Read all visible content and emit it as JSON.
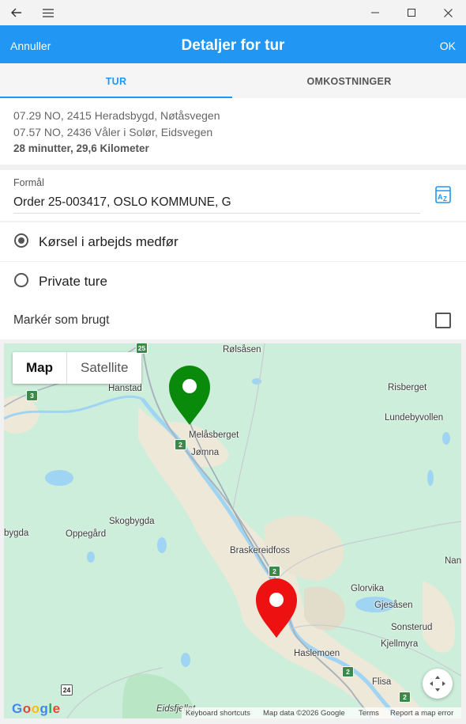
{
  "titlebar": {
    "back_icon": "arrow-left-icon",
    "menu_icon": "hamburger-icon",
    "minimize_icon": "minimize-icon",
    "maximize_icon": "maximize-icon",
    "close_icon": "close-icon"
  },
  "appbar": {
    "cancel": "Annuller",
    "title": "Detaljer for tur",
    "ok": "OK",
    "color": "#2196f3"
  },
  "tabs": [
    {
      "label": "TUR",
      "active": true
    },
    {
      "label": "OMKOSTNINGER",
      "active": false
    }
  ],
  "trip": {
    "start": "07.29 NO, 2415 Heradsbygd, Nøtåsvegen",
    "end": "07.57 NO, 2436 Våler i Solør, Eidsvegen",
    "summary": "28 minutter, 29,6 Kilometer"
  },
  "purpose": {
    "label": "Formål",
    "value": "Order 25-003417, OSLO KOMMUNE, G",
    "sort_icon": "az-sort-icon"
  },
  "trip_type": {
    "options": [
      "Kørsel i arbejds medfør",
      "Private ture"
    ],
    "selected": 0
  },
  "mark_used": {
    "label": "Markér som brugt",
    "checked": false
  },
  "map": {
    "type_buttons": {
      "map": "Map",
      "satellite": "Satellite"
    },
    "selected_type": "Map",
    "places": {
      "rolsasen": "Rølsåsen",
      "hanstad": "Hanstad",
      "risberget": "Risberget",
      "lundebyvollen": "Lundebyvollen",
      "melasberget": "Melåsberget",
      "jomna": "Jømna",
      "skogbygda": "Skogbygda",
      "oppegard": "Oppegård",
      "bygda": "bygda",
      "braskereidfoss": "Braskereidfoss",
      "nan": "Nan",
      "glorvika": "Glorvika",
      "gjesasen": "Gjesåsen",
      "sonsterud": "Sonsterud",
      "kjellmyra": "Kjellmyra",
      "haslemoen": "Haslemoen",
      "flisa": "Flisa",
      "eidsfjellet": "Eidsfjellet"
    },
    "roads": {
      "r25": "25",
      "r3": "3",
      "r2a": "2",
      "r2b": "2",
      "r2c": "2",
      "r2d": "2",
      "r24": "24"
    },
    "start_marker_color": "#0a8a0a",
    "end_marker_color": "#ee1111",
    "logo": "Google",
    "footer": {
      "shortcuts": "Keyboard shortcuts",
      "data": "Map data ©2026 Google",
      "terms": "Terms",
      "report": "Report a map error"
    },
    "locate_icon": "my-location-icon"
  }
}
